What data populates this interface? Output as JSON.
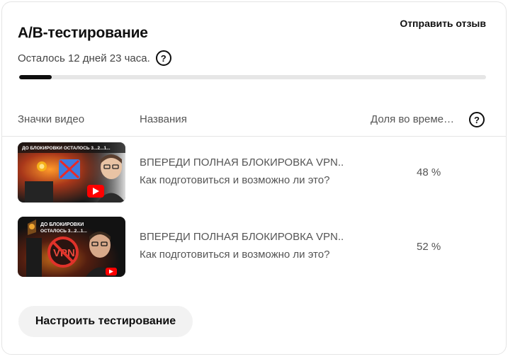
{
  "card": {
    "title": "A/B-тестирование",
    "feedback_label": "Отправить отзыв",
    "remaining": "Осталось 12 дней 23 часа.",
    "help_symbol": "?",
    "progress_fraction": 0.07
  },
  "table": {
    "headers": {
      "thumbnails": "Значки видео",
      "titles": "Названия",
      "share": "Доля во време…"
    },
    "rows": [
      {
        "thumb_text": "ДО БЛОКИРОВКИ ОСТАЛОСЬ 3...2...1...",
        "title_line1": "ВПЕРЕДИ ПОЛНАЯ БЛОКИРОВКА VPN..",
        "title_line2": "Как подготовиться и возможно ли это?",
        "share": "48 %"
      },
      {
        "thumb_text_line1": "ДО БЛОКИРОВКИ",
        "thumb_text_line2": "ОСТАЛОСЬ 3...2...1...",
        "thumb_vpn": "VPN",
        "title_line1": "ВПЕРЕДИ ПОЛНАЯ БЛОКИРОВКА VPN..",
        "title_line2": "Как подготовиться и возможно ли это?",
        "share": "52 %"
      }
    ]
  },
  "actions": {
    "setup_label": "Настроить тестирование"
  },
  "colors": {
    "accent": "#0f0f0f",
    "youtube_red": "#ff0000",
    "track": "#e6e6e6",
    "button_bg": "#f2f2f2"
  }
}
